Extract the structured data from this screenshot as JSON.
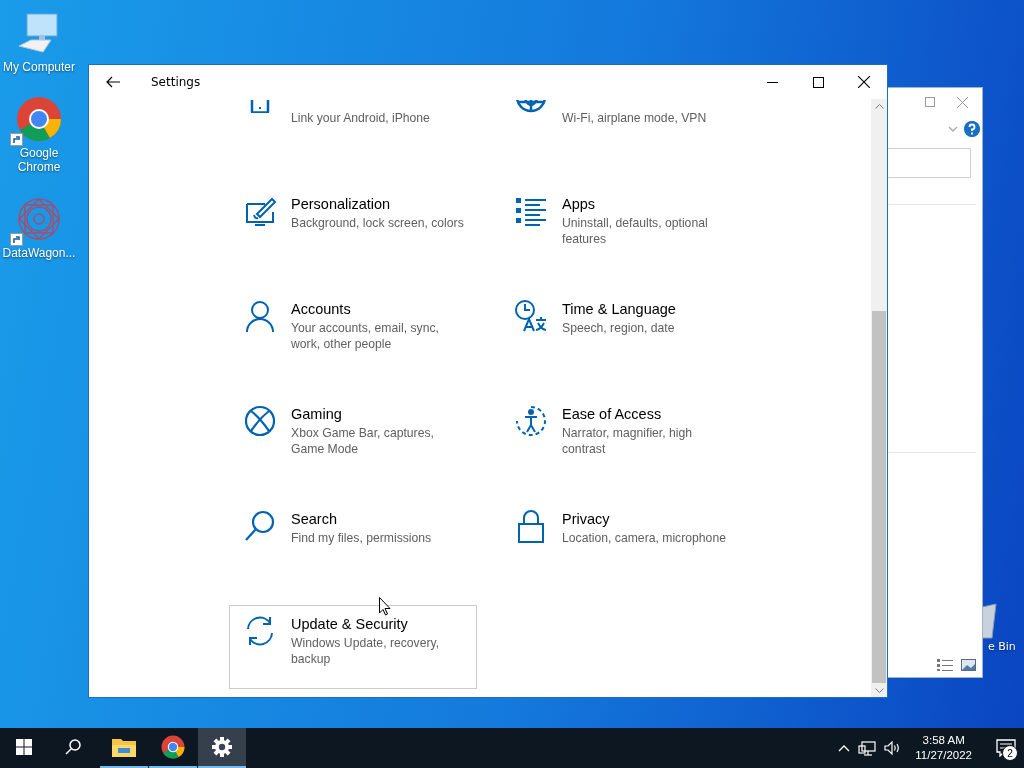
{
  "desktop_icons": [
    {
      "kind": "computer",
      "label": "My Computer",
      "shortcut": false
    },
    {
      "kind": "chrome",
      "label": "Google Chrome",
      "shortcut": true
    },
    {
      "kind": "pattern",
      "label": "DataWagon...",
      "shortcut": true
    }
  ],
  "recycle_bin": {
    "label": "e Bin"
  },
  "settings_window": {
    "title": "Settings",
    "tiles": [
      {
        "kind": "phone",
        "description": "Link your Android, iPhone",
        "hovered": false
      },
      {
        "kind": "globe",
        "description": "Wi-Fi, airplane mode, VPN",
        "hovered": false
      },
      {
        "kind": "brush",
        "title": "Personalization",
        "description": "Background, lock screen, colors",
        "hovered": false
      },
      {
        "kind": "apps",
        "title": "Apps",
        "description": "Uninstall, defaults, optional features",
        "hovered": false
      },
      {
        "kind": "person",
        "title": "Accounts",
        "description": "Your accounts, email, sync, work, other people",
        "hovered": false
      },
      {
        "kind": "language",
        "title": "Time & Language",
        "description": "Speech, region, date",
        "hovered": false
      },
      {
        "kind": "xbox",
        "title": "Gaming",
        "description": "Xbox Game Bar, captures, Game Mode",
        "hovered": false
      },
      {
        "kind": "access",
        "title": "Ease of Access",
        "description": "Narrator, magnifier, high contrast",
        "hovered": false
      },
      {
        "kind": "search",
        "title": "Search",
        "description": "Find my files, permissions",
        "hovered": false
      },
      {
        "kind": "lock",
        "title": "Privacy",
        "description": "Location, camera, microphone",
        "hovered": false
      },
      {
        "kind": "update",
        "title": "Update & Security",
        "description": "Windows Update, recovery, backup",
        "hovered": true
      }
    ]
  },
  "taskbar": {
    "buttons": [
      {
        "kind": "start"
      },
      {
        "kind": "search"
      }
    ],
    "apps": [
      {
        "kind": "explorer",
        "open": true,
        "selected": false
      },
      {
        "kind": "chrome",
        "open": true,
        "selected": false
      },
      {
        "kind": "settings",
        "open": true,
        "selected": true
      }
    ],
    "time": "3:58 AM",
    "date": "11/27/2022",
    "notification_count": "2"
  }
}
